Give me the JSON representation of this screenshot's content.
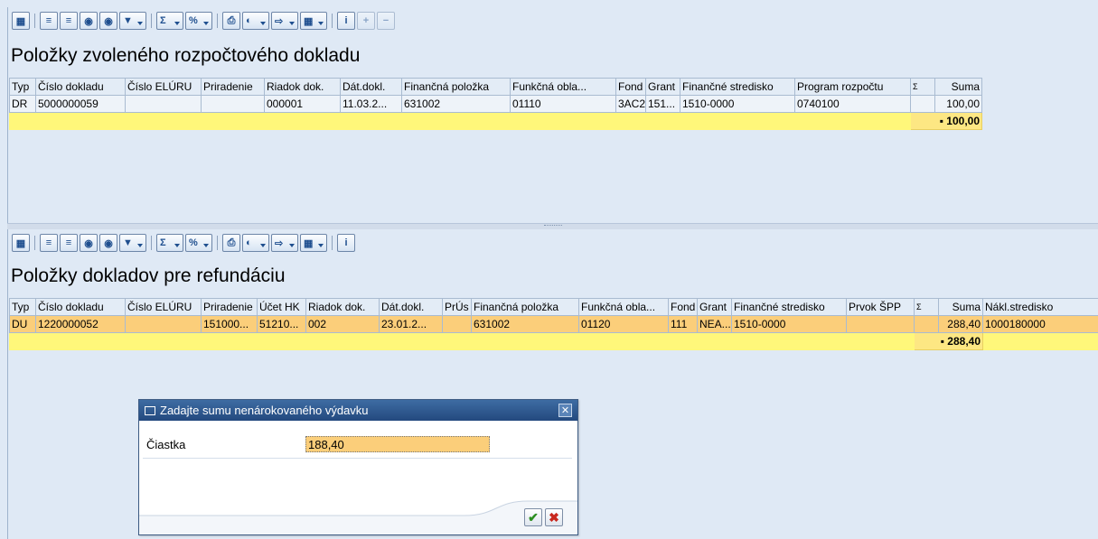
{
  "toolbar_icons": [
    "details-icon",
    "sort-ascending-icon",
    "sort-descending-icon",
    "find-icon",
    "find-next-icon",
    "filter-icon",
    "sum-icon",
    "subtotal-icon",
    "print-icon",
    "views-icon",
    "export-icon",
    "layout-icon",
    "info-icon",
    "add-row-icon",
    "delete-row-icon"
  ],
  "top": {
    "title": "Položky zvoleného rozpočtového dokladu",
    "columns": [
      "Typ",
      "Číslo dokladu",
      "Číslo ELÚRU",
      "Priradenie",
      "Riadok dok.",
      "Dát.dokl.",
      "Finančná položka",
      "Funkčná obla...",
      "Fond",
      "Grant",
      "Finančné stredisko",
      "Program rozpočtu",
      "Ʃ",
      "Suma"
    ],
    "rows": [
      [
        "DR",
        "5000000059",
        "",
        "",
        "000001",
        "11.03.2...",
        "631002",
        "01110",
        "3AC2",
        "151...",
        "1510-0000",
        "0740100",
        "",
        "100,00"
      ]
    ],
    "total": "▪ 100,00"
  },
  "bottom": {
    "title": "Položky dokladov pre refundáciu",
    "columns": [
      "Typ",
      "Číslo dokladu",
      "Číslo ELÚRU",
      "Priradenie",
      "Účet HK",
      "Riadok dok.",
      "Dát.dokl.",
      "PrÚs",
      "Finančná položka",
      "Funkčná obla...",
      "Fond",
      "Grant",
      "Finančné stredisko",
      "Prvok ŠPP",
      "Ʃ",
      "Suma",
      "Nákl.stredisko"
    ],
    "rows": [
      [
        "DU",
        "1220000052",
        "",
        "151000...",
        "51210...",
        "002",
        "23.01.2...",
        "",
        "631002",
        "01120",
        "111",
        "NEA...",
        "1510-0000",
        "",
        "",
        "288,40",
        "1000180000"
      ]
    ],
    "total": "▪ 288,40"
  },
  "dialog": {
    "title": "Zadajte sumu nenárokovaného výdavku",
    "label": "Čiastka",
    "value": "188,40",
    "ok_icon": "checkmark-icon",
    "cancel_icon": "cancel-icon"
  }
}
